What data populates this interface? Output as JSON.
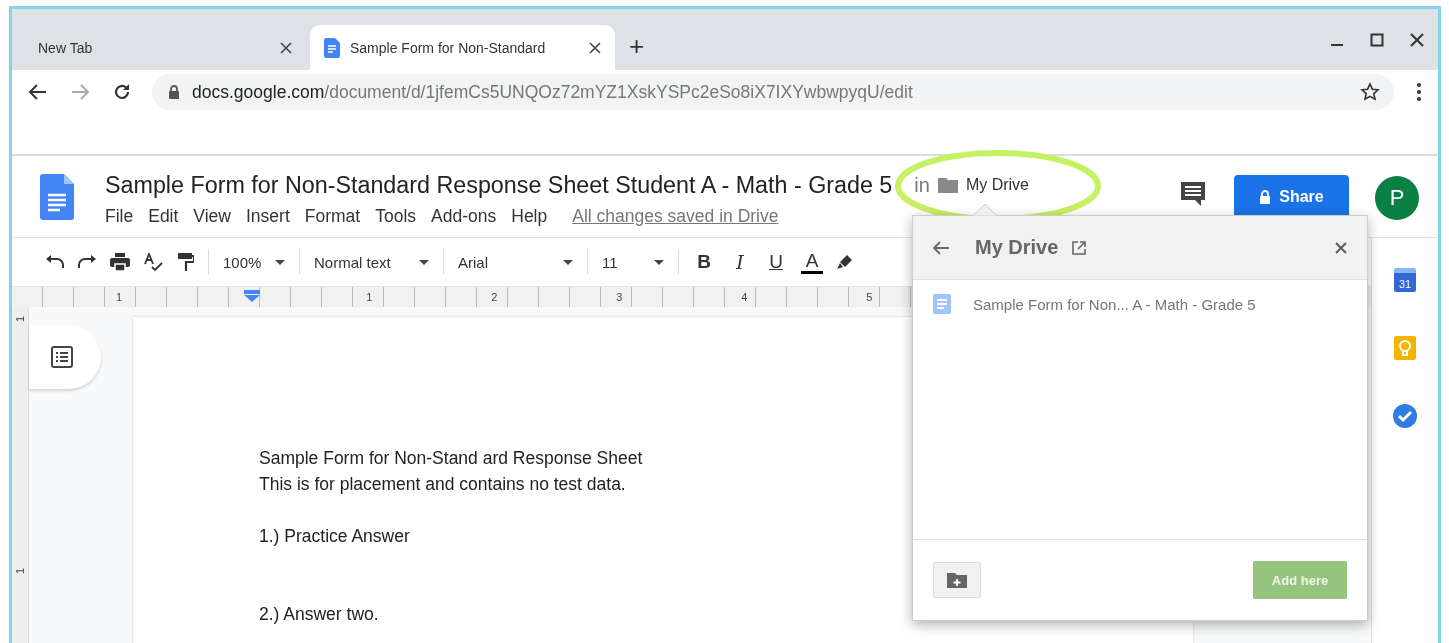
{
  "browser": {
    "tabs": [
      {
        "title": "New Tab",
        "selected": false
      },
      {
        "title": "Sample Form for Non-Standard",
        "selected": true
      }
    ],
    "new_tab": "+",
    "url": {
      "host": "docs.google.com",
      "path": "/document/d/1jfemCs5UNQOz72mYZ1XskYSPc2eSo8iX7IXYwbwpyqU/edit"
    }
  },
  "document": {
    "title": "Sample Form for Non-Standard Response Sheet Student A - Math - Grade 5",
    "location_prefix": "in",
    "location": "My Drive",
    "menu": [
      "File",
      "Edit",
      "View",
      "Insert",
      "Format",
      "Tools",
      "Add-ons",
      "Help"
    ],
    "save_status": "All changes saved in Drive",
    "share": "Share",
    "avatar": "P"
  },
  "toolbar": {
    "zoom": "100%",
    "style": "Normal text",
    "font": "Arial",
    "size": "11",
    "format": [
      "B",
      "I",
      "U",
      "A"
    ]
  },
  "ruler": {
    "labels": [
      "1",
      "1",
      "2",
      "3",
      "4",
      "5"
    ]
  },
  "vertical_ruler": {
    "labels": [
      "1",
      "1"
    ]
  },
  "page": {
    "blocks": [
      {
        "lines": [
          "Sample Form for Non-Stand ard Response Sheet",
          "This is for placement and contains no test data."
        ]
      },
      {
        "lines": [
          "1.) Practice Answer"
        ]
      },
      {
        "lines": [
          "2.) Answer two."
        ]
      }
    ]
  },
  "side_panel": {
    "calendar_day": "31"
  },
  "move_dialog": {
    "title": "My Drive",
    "items": [
      {
        "name": "Sample Form for Non... A - Math - Grade 5"
      }
    ],
    "add_button": {
      "label": "Add here",
      "disabled": true
    }
  }
}
